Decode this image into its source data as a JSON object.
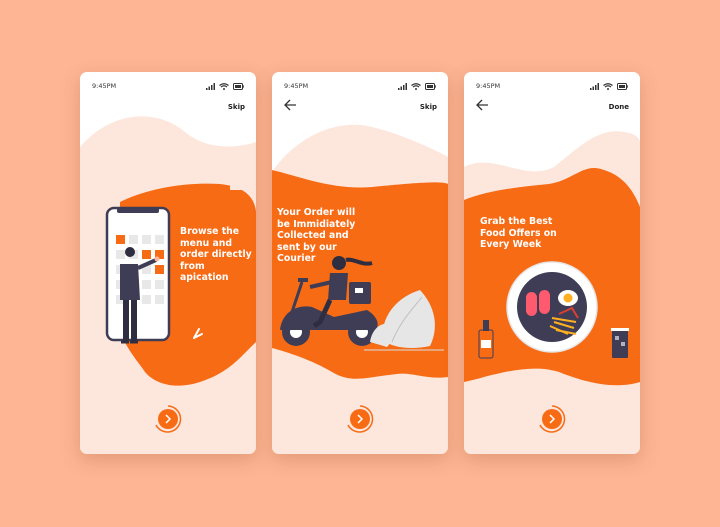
{
  "screens": [
    {
      "time": "9:45PM",
      "action": "Skip",
      "has_back": false,
      "caption": "Browse the\nmenu and\norder directly\nfrom\napication"
    },
    {
      "time": "9:45PM",
      "action": "Skip",
      "has_back": true,
      "caption": "Your Order will\nbe Immidiately\nCollected and\nsent by our\nCourier"
    },
    {
      "time": "9:45PM",
      "action": "Done",
      "has_back": true,
      "caption": "Grab the Best\nFood Offers on\nEvery Week"
    }
  ],
  "icons": {
    "signal": "signal-icon",
    "wifi": "wifi-icon",
    "battery": "battery-icon",
    "back": "back-arrow-icon",
    "next": "chevron-right-icon"
  },
  "colors": {
    "background": "#fdb593",
    "accent": "#f76b15",
    "blob_light": "#fde6dc",
    "dark": "#3f3d56"
  }
}
